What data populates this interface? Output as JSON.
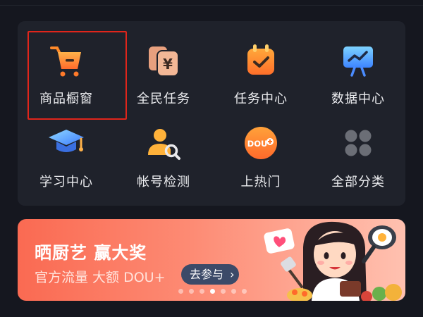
{
  "grid": {
    "items": [
      {
        "label": "商品橱窗",
        "icon": "shopping-cart-icon"
      },
      {
        "label": "全民任务",
        "icon": "yuan-coins-icon"
      },
      {
        "label": "任务中心",
        "icon": "calendar-check-icon"
      },
      {
        "label": "数据中心",
        "icon": "data-chart-board-icon"
      },
      {
        "label": "学习中心",
        "icon": "graduation-cap-icon"
      },
      {
        "label": "帐号检测",
        "icon": "user-search-icon"
      },
      {
        "label": "上热门",
        "icon": "dou-plus-icon"
      },
      {
        "label": "全部分类",
        "icon": "all-categories-grid-icon"
      }
    ]
  },
  "banner": {
    "title": "晒厨艺 赢大奖",
    "subtitle": "官方流量 大额 DOU+",
    "button_label": "去参与",
    "button_chevron": "›",
    "dots_total": 7,
    "active_dot": 3
  },
  "colors": {
    "background": "#15171f",
    "card": "#1f222b",
    "highlight": "#e0251b",
    "orange": "#ff8a2a",
    "blue": "#4aa3ff",
    "banner_start": "#fa6a52"
  }
}
